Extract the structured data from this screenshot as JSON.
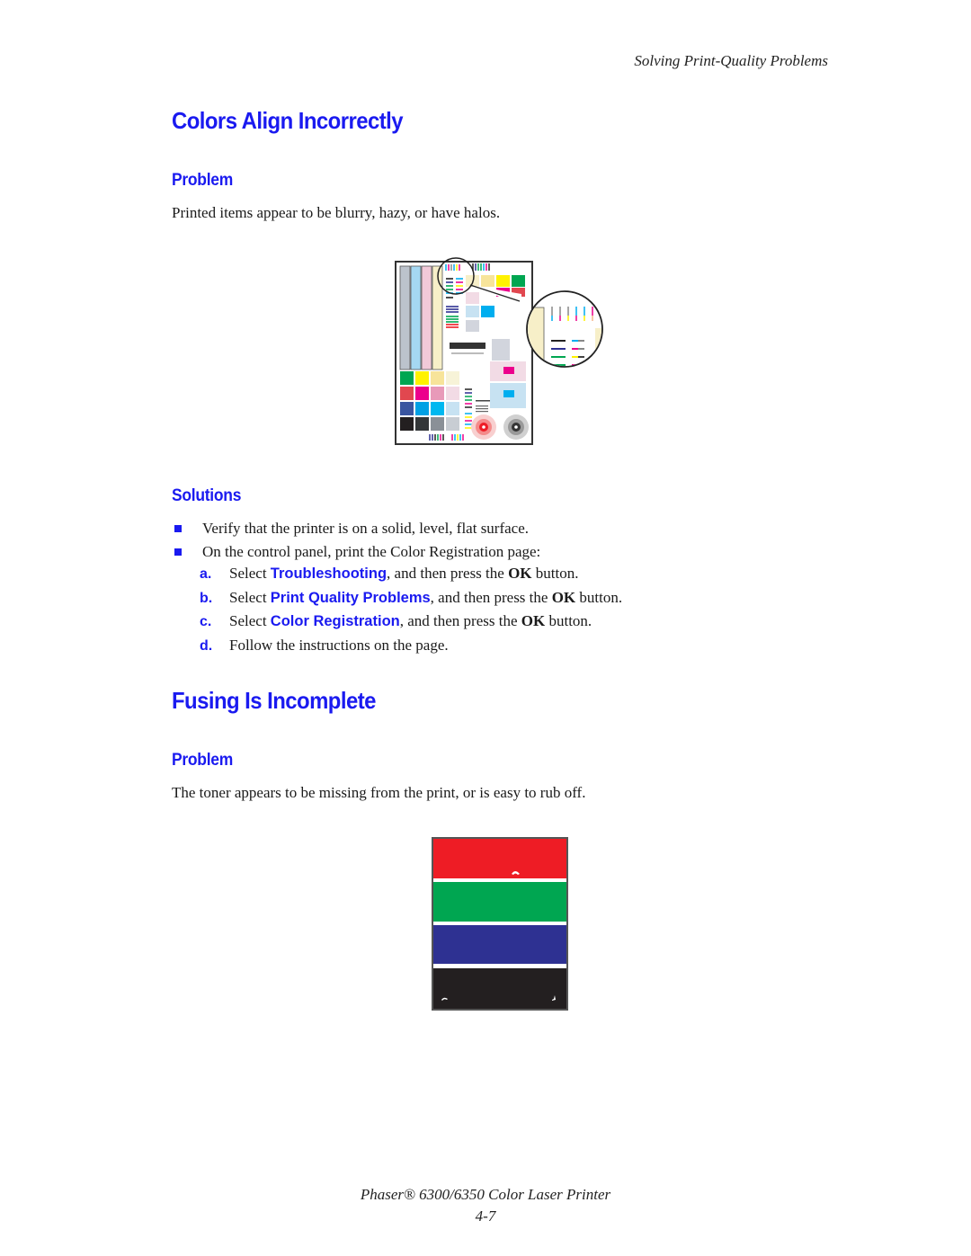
{
  "running_head": "Solving Print-Quality Problems",
  "sections": [
    {
      "title": "Colors Align Incorrectly",
      "problem_heading": "Problem",
      "problem_text": "Printed items appear to be blurry, hazy, or have halos.",
      "figure": "color-registration-page-with-magnified-detail",
      "solutions_heading": "Solutions",
      "bullets": [
        "Verify that the printer is on a solid, level, flat surface.",
        "On the control panel, print the Color Registration page:"
      ],
      "steps": [
        {
          "letter": "a.",
          "prefix": "Select ",
          "term": "Troubleshooting",
          "suffix_1": ", and then press the ",
          "ok": "OK",
          "suffix_2": " button."
        },
        {
          "letter": "b.",
          "prefix": "Select ",
          "term": "Print Quality Problems",
          "suffix_1": ", and then press the ",
          "ok": "OK",
          "suffix_2": " button."
        },
        {
          "letter": "c.",
          "prefix": "Select ",
          "term": "Color Registration",
          "suffix_1": ", and then press the ",
          "ok": "OK",
          "suffix_2": " button."
        },
        {
          "letter": "d.",
          "text": "Follow the instructions on the page."
        }
      ]
    },
    {
      "title": "Fusing Is Incomplete",
      "problem_heading": "Problem",
      "problem_text": "The toner appears to be missing from the print, or is easy to rub off.",
      "figure": "color-bands-with-rubbed-off-toner",
      "band_colors": [
        "#ee1c25",
        "#00a651",
        "#2e3192",
        "#231f20"
      ]
    }
  ],
  "colors": {
    "heading_blue": "#1a1af0",
    "body_text": "#1a1a1a"
  },
  "footer": {
    "product": "Phaser® 6300/6350 Color Laser Printer",
    "page_number": "4-7"
  }
}
